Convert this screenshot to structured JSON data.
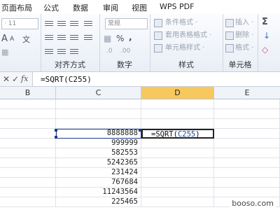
{
  "tabs": [
    "页面布局",
    "公式",
    "数据",
    "审阅",
    "视图",
    "WPS PDF"
  ],
  "ribbon": {
    "font_size": "11",
    "number_format": "常规",
    "groups": {
      "alignment": "对齐方式",
      "number": "数字",
      "styles": "样式",
      "cells": "单元格"
    },
    "style_items": [
      "条件格式 ·",
      "套用表格格式 ·",
      "单元格样式 ·"
    ],
    "cell_items": [
      "插入 ·",
      "删除 ·",
      "格式 ·"
    ],
    "symbols": {
      "percent": "%",
      "comma": ",",
      "sigma": "Σ",
      "fill": "↓",
      "clear": "◇",
      "font_grow": "A",
      "font_shrink": "A",
      "wen": "文"
    }
  },
  "formula_bar": {
    "cancel": "✕",
    "enter": "✓",
    "fx": "fx",
    "content": "=SQRT(C255)"
  },
  "columns": {
    "B": "B",
    "C": "C",
    "D": "D",
    "E": "E"
  },
  "cells": {
    "c_values": [
      "8888888",
      "999999",
      "582553",
      "5242365",
      "231424",
      "767684",
      "11243564",
      "225465"
    ],
    "d_edit_prefix": "=SQRT(",
    "d_edit_ref": "C255",
    "d_edit_suffix": ")"
  },
  "watermark": "booso.com",
  "colors": {
    "selected_column_header": "#f7c85e",
    "selection_border": "#1e3a8a",
    "reference_blue": "#1f4fa8"
  }
}
